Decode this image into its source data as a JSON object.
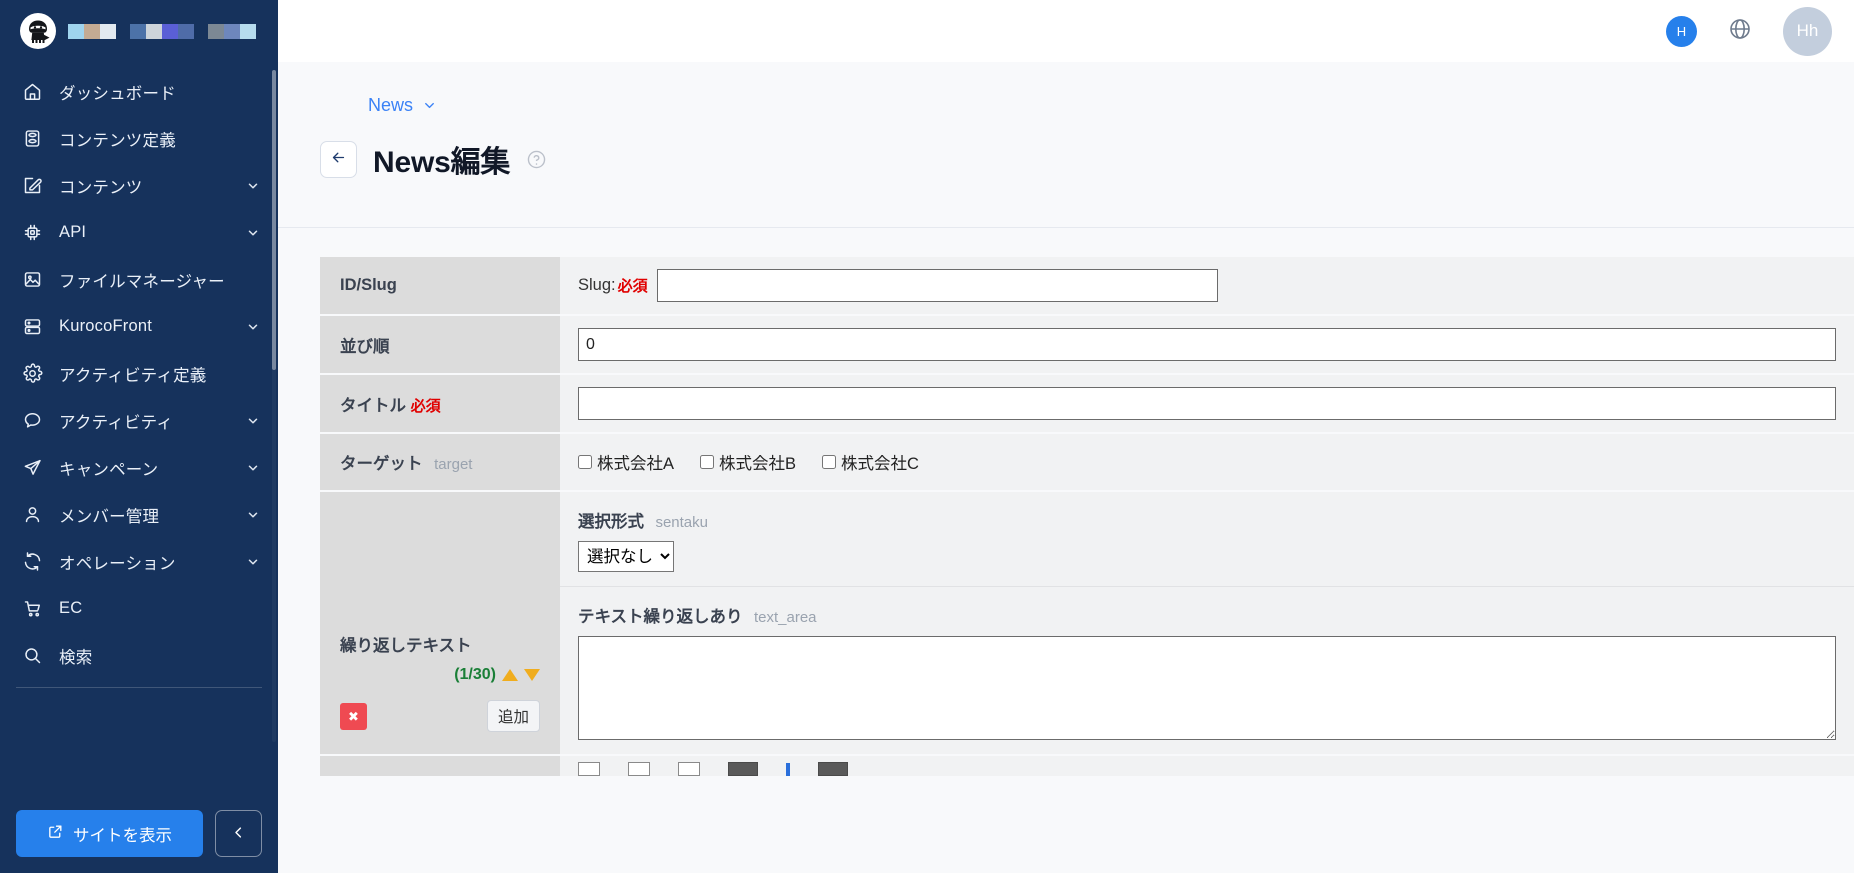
{
  "brand": {
    "logo_alt": "kuroco-ninja-logo",
    "block_colors_1": [
      "#9fd4ee",
      "#c4ab93",
      "#e3eaf0"
    ],
    "block_colors_2": [
      "#4c72a8",
      "#cdd4da",
      "#5a5fd6",
      "#4f6ca8"
    ],
    "block_colors_3": [
      "#7c8894",
      "#6e87bc",
      "#b6dcee"
    ]
  },
  "sidebar": {
    "items": [
      {
        "label": "ダッシュボード",
        "icon": "home-icon",
        "expandable": false
      },
      {
        "label": "コンテンツ定義",
        "icon": "database-icon",
        "expandable": false
      },
      {
        "label": "コンテンツ",
        "icon": "edit-square-icon",
        "expandable": true
      },
      {
        "label": "API",
        "icon": "chip-icon",
        "expandable": true
      },
      {
        "label": "ファイルマネージャー",
        "icon": "image-icon",
        "expandable": false
      },
      {
        "label": "KurocoFront",
        "icon": "server-icon",
        "expandable": true
      },
      {
        "label": "アクティビティ定義",
        "icon": "gear-icon",
        "expandable": false
      },
      {
        "label": "アクティビティ",
        "icon": "chat-bubble-icon",
        "expandable": true
      },
      {
        "label": "キャンペーン",
        "icon": "send-icon",
        "expandable": true
      },
      {
        "label": "メンバー管理",
        "icon": "user-icon",
        "expandable": true
      },
      {
        "label": "オペレーション",
        "icon": "refresh-icon",
        "expandable": true
      },
      {
        "label": "EC",
        "icon": "cart-icon",
        "expandable": false
      },
      {
        "label": "検索",
        "icon": "search-icon",
        "expandable": false
      }
    ],
    "view_site_button": "サイトを表示",
    "collapse_button": "‹"
  },
  "topbar": {
    "notification_initial": "H",
    "globe_icon": "globe-icon",
    "user_initials": "Hh"
  },
  "page": {
    "breadcrumb": "News",
    "title": "News編集",
    "help_icon": "question-circle-icon",
    "back_icon": "arrow-left-icon"
  },
  "form": {
    "rows": [
      {
        "label": "ID/Slug",
        "type": "slug",
        "slug_prefix": "Slug:",
        "required_badge": "必須",
        "value": "",
        "placeholder": ""
      },
      {
        "label": "並び順",
        "type": "text",
        "value": "0",
        "placeholder": ""
      },
      {
        "label": "タイトル",
        "required_badge": "必須",
        "type": "text",
        "value": "",
        "placeholder": ""
      },
      {
        "label": "ターゲット",
        "code": "target",
        "type": "checkboxes",
        "options": [
          {
            "label": "株式会社A",
            "checked": false
          },
          {
            "label": "株式会社B",
            "checked": false
          },
          {
            "label": "株式会社C",
            "checked": false
          }
        ]
      }
    ],
    "repeat_section": {
      "label": "繰り返しテキスト",
      "counter": "(1/30)",
      "up_icon": "triangle-up-icon",
      "down_icon": "triangle-down-icon",
      "delete_button": "✖",
      "add_button": "追加",
      "select_field": {
        "label": "選択形式",
        "code": "sentaku",
        "value": "選択なし",
        "options": [
          "選択なし"
        ]
      },
      "textarea_field": {
        "label": "テキスト繰り返しあり",
        "code": "text_area",
        "value": "",
        "placeholder": ""
      }
    }
  },
  "colors": {
    "sidebar_bg": "#16325c",
    "accent_blue": "#2680eb",
    "link_blue": "#3b82f6",
    "required_red": "#e00000",
    "counter_green": "#1a7f37",
    "triangle_orange": "#f0ad1e",
    "delete_red": "#ef4a52",
    "label_cell_bg": "#dcdcdc",
    "value_cell_bg": "#f1f2f3"
  }
}
